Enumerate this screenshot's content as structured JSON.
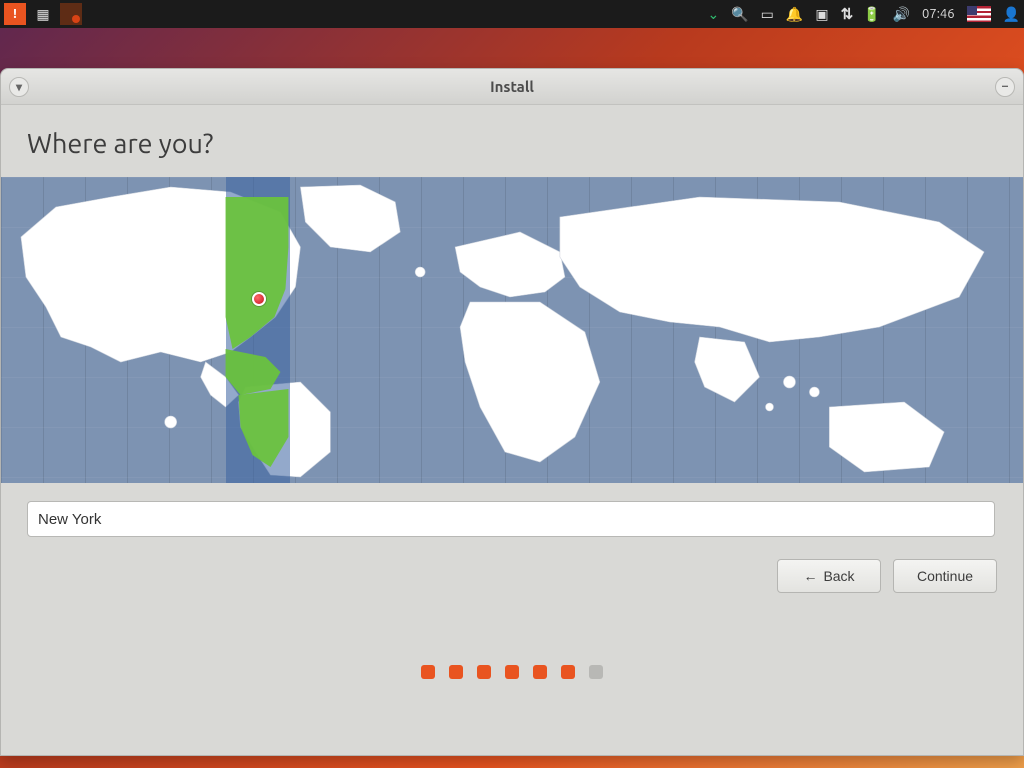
{
  "panel": {
    "time": "07:46"
  },
  "window": {
    "title": "Install"
  },
  "page": {
    "heading": "Where are you?"
  },
  "timezone": {
    "value": "New York"
  },
  "buttons": {
    "back": "Back",
    "continue": "Continue"
  },
  "progress": {
    "total": 7,
    "active": 6
  }
}
